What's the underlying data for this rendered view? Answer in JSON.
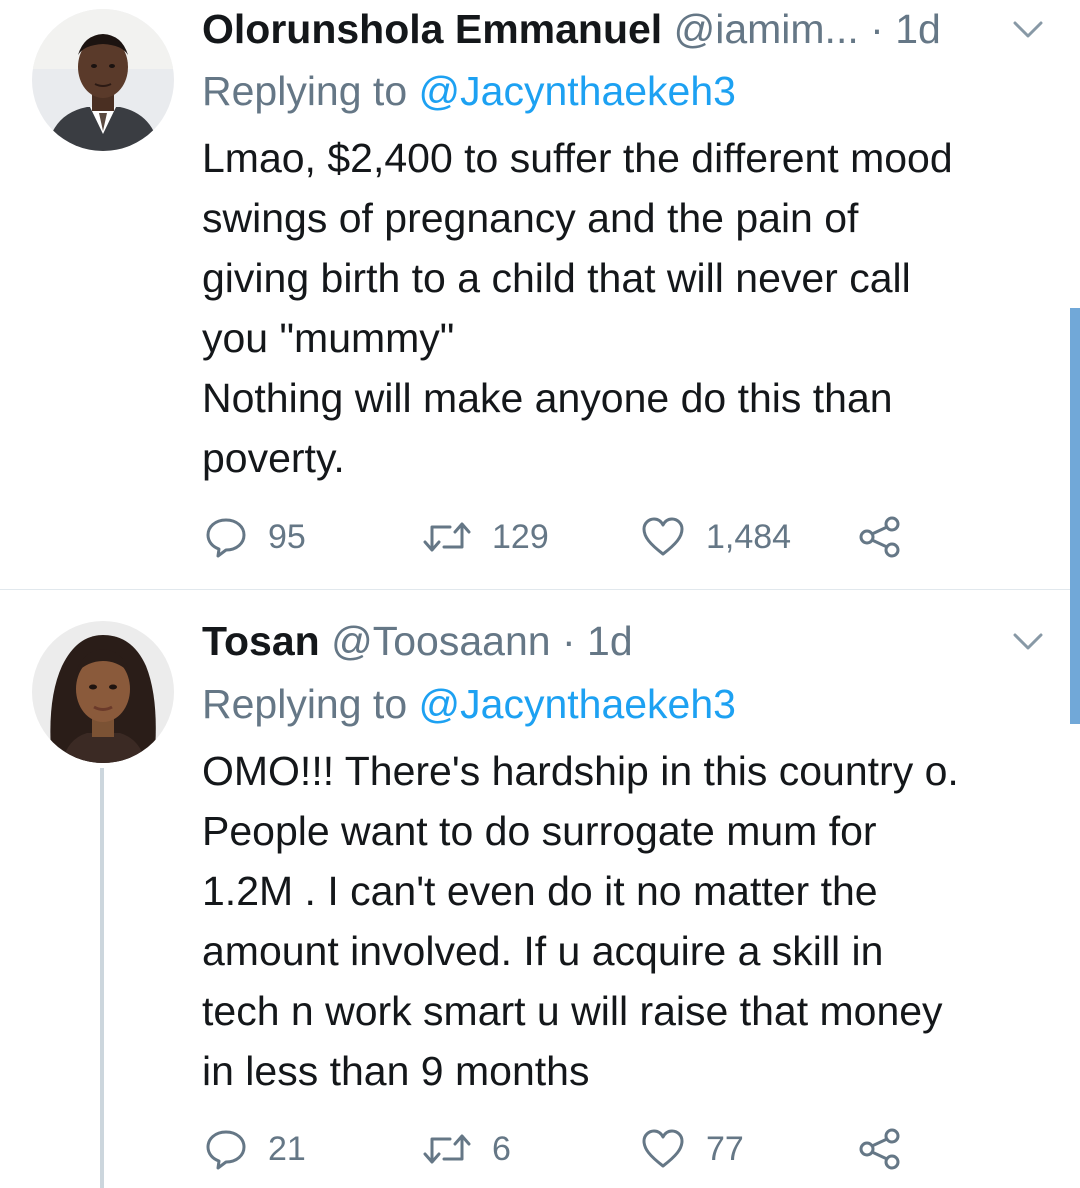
{
  "tweets": [
    {
      "name": "Olorunshola Emmanuel",
      "handle": "@iamim...",
      "dot": "·",
      "time": "1d",
      "replying_label": "Replying to",
      "replying_handle": "@Jacynthaekeh3",
      "body_lines": [
        "Lmao, $2,400 to suffer the different mood",
        "swings of pregnancy and the pain of",
        "giving birth to a child that will never call",
        "you \"mummy\"",
        "Nothing will make anyone do this than",
        "poverty."
      ],
      "reply_count": "95",
      "retweet_count": "129",
      "like_count": "1,484"
    },
    {
      "name": "Tosan",
      "handle": "@Toosaann",
      "dot": "·",
      "time": "1d",
      "replying_label": "Replying to",
      "replying_handle": "@Jacynthaekeh3",
      "body_lines": [
        "OMO!!!  There's hardship in this country o.",
        "People want to do surrogate mum for",
        "1.2M . I can't even do it no matter the",
        "amount involved. If u acquire a skill in",
        "tech n work smart u will raise that money",
        "in less than 9 months"
      ],
      "reply_count": "21",
      "retweet_count": "6",
      "like_count": "77"
    }
  ],
  "icons": {
    "reply": "reply-icon",
    "retweet": "retweet-icon",
    "like": "heart-icon",
    "share": "share-icon",
    "menu": "chevron-down-icon"
  },
  "colors": {
    "text": "#14171a",
    "secondary": "#657786",
    "link": "#1da1f2",
    "divider": "#e1e8ed",
    "thread_line": "#ccd6dd",
    "scrollbar": "#71a8d8"
  }
}
